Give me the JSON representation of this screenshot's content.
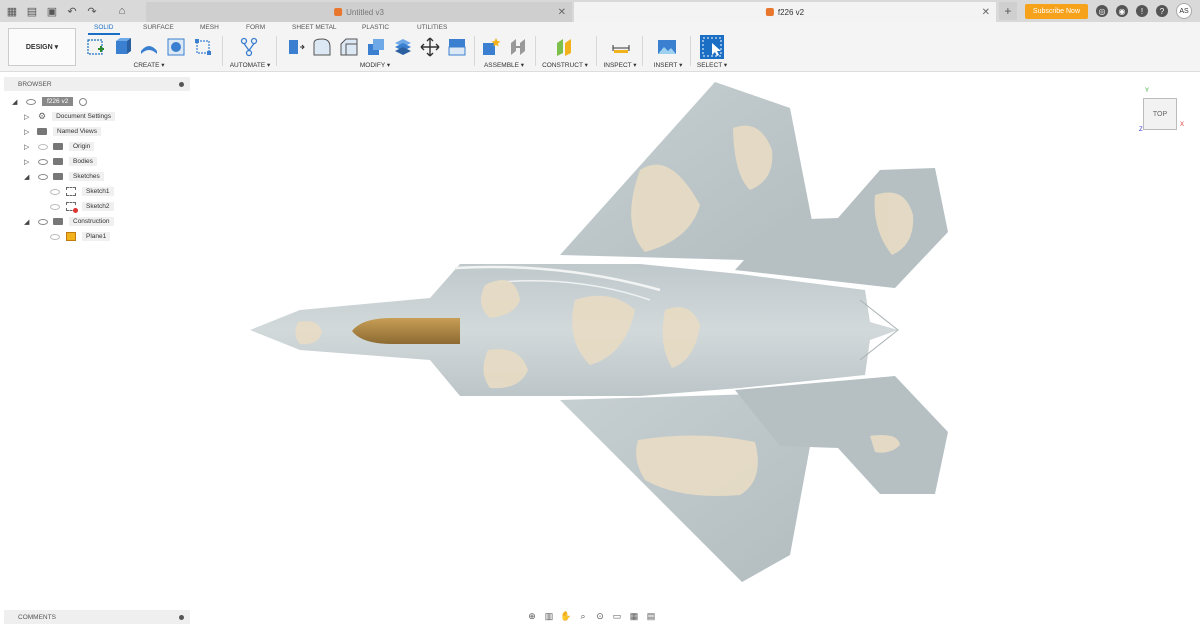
{
  "titlebar": {
    "tabs": [
      {
        "label": "Untitled v3",
        "active": false
      },
      {
        "label": "f226 v2",
        "active": true
      }
    ],
    "subscribe_label": "Subscribe Now",
    "user_initials": "AS"
  },
  "toolbar": {
    "design_label": "DESIGN ▾",
    "workspace_tabs": [
      "SOLID",
      "SURFACE",
      "MESH",
      "FORM",
      "SHEET METAL",
      "PLASTIC",
      "UTILITIES"
    ],
    "groups": [
      "CREATE ▾",
      "AUTOMATE ▾",
      "MODIFY ▾",
      "ASSEMBLE ▾",
      "CONSTRUCT ▾",
      "INSPECT ▾",
      "INSERT ▾",
      "SELECT ▾"
    ]
  },
  "browser": {
    "header": "BROWSER",
    "root": "f226 v2",
    "items": [
      {
        "label": "Document Settings"
      },
      {
        "label": "Named Views"
      },
      {
        "label": "Origin"
      },
      {
        "label": "Bodies"
      },
      {
        "label": "Sketches"
      },
      {
        "label": "Sketch1"
      },
      {
        "label": "Sketch2"
      },
      {
        "label": "Construction"
      },
      {
        "label": "Plane1"
      }
    ]
  },
  "comments": {
    "label": "COMMENTS"
  },
  "viewcube": {
    "face": "TOP",
    "x": "X",
    "y": "Y",
    "z": "Z"
  },
  "colors": {
    "accent": "#1a6fc4",
    "subscribe": "#f7a21b",
    "body": "#c4ccce",
    "camo": "#e8dcc4",
    "nose": "#b08a4a"
  }
}
